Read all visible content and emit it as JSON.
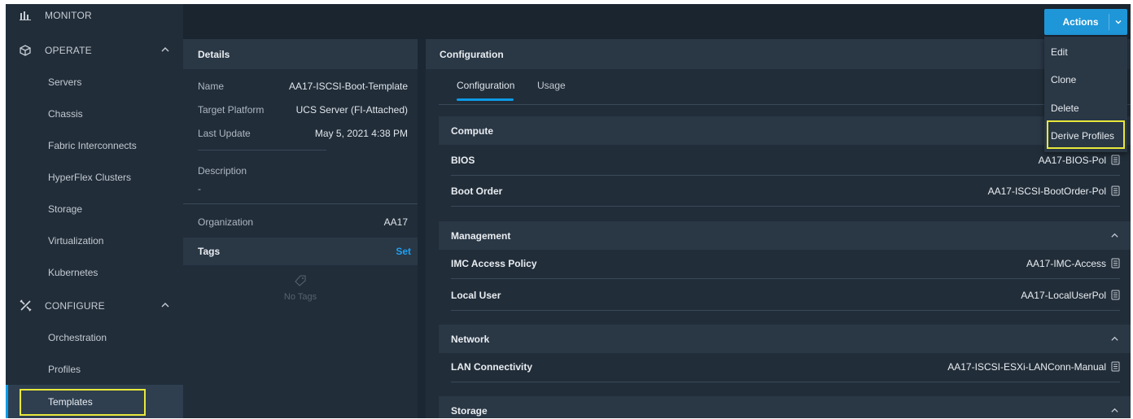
{
  "sidebar": {
    "monitor": "MONITOR",
    "operate": "OPERATE",
    "operate_items": [
      "Servers",
      "Chassis",
      "Fabric Interconnects",
      "HyperFlex Clusters",
      "Storage",
      "Virtualization",
      "Kubernetes"
    ],
    "configure": "CONFIGURE",
    "configure_items": [
      "Orchestration",
      "Profiles",
      "Templates"
    ]
  },
  "actions": {
    "label": "Actions",
    "menu": [
      "Edit",
      "Clone",
      "Delete",
      "Derive Profiles"
    ]
  },
  "details": {
    "title": "Details",
    "name_label": "Name",
    "name_value": "AA17-ISCSI-Boot-Template",
    "platform_label": "Target Platform",
    "platform_value": "UCS Server (FI-Attached)",
    "update_label": "Last Update",
    "update_value": "May 5, 2021 4:38 PM",
    "description_label": "Description",
    "description_value": "-",
    "org_label": "Organization",
    "org_value": "AA17",
    "tags_label": "Tags",
    "tags_action": "Set",
    "no_tags": "No Tags"
  },
  "config": {
    "title": "Configuration",
    "tabs": [
      "Configuration",
      "Usage"
    ],
    "groups": {
      "compute": "Compute",
      "management": "Management",
      "network": "Network",
      "storage": "Storage"
    },
    "rows": {
      "bios": {
        "label": "BIOS",
        "value": "AA17-BIOS-Pol"
      },
      "boot": {
        "label": "Boot Order",
        "value": "AA17-ISCSI-BootOrder-Pol"
      },
      "imc": {
        "label": "IMC Access Policy",
        "value": "AA17-IMC-Access"
      },
      "user": {
        "label": "Local User",
        "value": "AA17-LocalUserPol"
      },
      "lan": {
        "label": "LAN Connectivity",
        "value": "AA17-ISCSI-ESXi-LANConn-Manual"
      }
    }
  },
  "colors": {
    "accent": "#1f96d8",
    "highlight": "#e8e83c",
    "background": "#1b2733"
  }
}
